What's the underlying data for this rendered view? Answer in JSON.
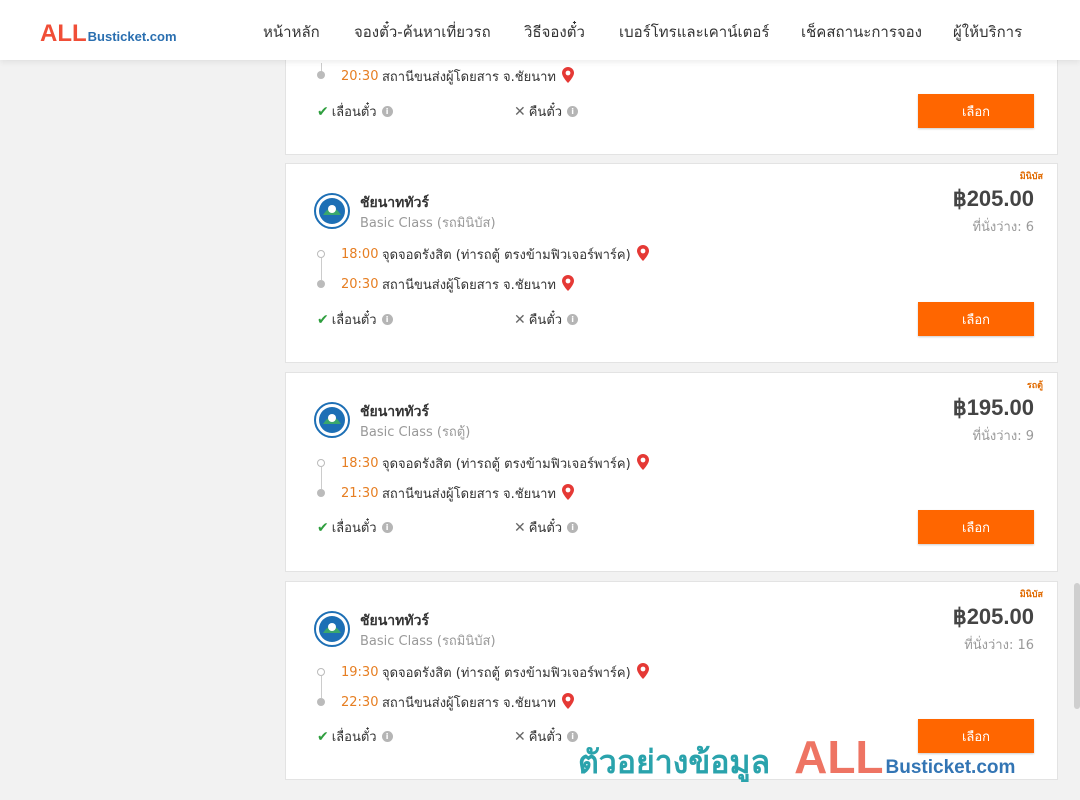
{
  "header": {
    "logo_all": "ALL",
    "logo_sub": "Busticket.com",
    "nav": [
      {
        "label": "หน้าหลัก"
      },
      {
        "label": "จองตั๋ว-ค้นหาเที่ยวรถ"
      },
      {
        "label": "วิธีจองตั๋ว"
      },
      {
        "label": "เบอร์โทรและเคาน์เตอร์"
      },
      {
        "label": "เช็คสถานะการจอง"
      },
      {
        "label": "ผู้ให้บริการ"
      }
    ]
  },
  "cards": [
    {
      "tag": "",
      "operator": "",
      "class": "",
      "price": "",
      "seats": "",
      "depart_time": "",
      "depart_stop": "",
      "arrive_time": "20:30",
      "arrive_stop": "สถานีขนส่งผู้โดยสาร จ.ชัยนาท",
      "change_label": "เลื่อนตั๋ว",
      "refund_label": "คืนตั๋ว",
      "select_label": "เลือก"
    },
    {
      "tag": "มินิบัส",
      "operator": "ชัยนาททัวร์",
      "class": "Basic Class (รถมินิบัส)",
      "price": "฿205.00",
      "seats": "ที่นั่งว่าง: 6",
      "depart_time": "18:00",
      "depart_stop": "จุดจอดรังสิต (ท่ารถตู้ ตรงข้ามฟิวเจอร์พาร์ค)",
      "arrive_time": "20:30",
      "arrive_stop": "สถานีขนส่งผู้โดยสาร จ.ชัยนาท",
      "change_label": "เลื่อนตั๋ว",
      "refund_label": "คืนตั๋ว",
      "select_label": "เลือก"
    },
    {
      "tag": "รถตู้",
      "operator": "ชัยนาททัวร์",
      "class": "Basic Class (รถตู้)",
      "price": "฿195.00",
      "seats": "ที่นั่งว่าง: 9",
      "depart_time": "18:30",
      "depart_stop": "จุดจอดรังสิต (ท่ารถตู้ ตรงข้ามฟิวเจอร์พาร์ค)",
      "arrive_time": "21:30",
      "arrive_stop": "สถานีขนส่งผู้โดยสาร จ.ชัยนาท",
      "change_label": "เลื่อนตั๋ว",
      "refund_label": "คืนตั๋ว",
      "select_label": "เลือก"
    },
    {
      "tag": "มินิบัส",
      "operator": "ชัยนาททัวร์",
      "class": "Basic Class (รถมินิบัส)",
      "price": "฿205.00",
      "seats": "ที่นั่งว่าง: 16",
      "depart_time": "19:30",
      "depart_stop": "จุดจอดรังสิต (ท่ารถตู้ ตรงข้ามฟิวเจอร์พาร์ค)",
      "arrive_time": "22:30",
      "arrive_stop": "สถานีขนส่งผู้โดยสาร จ.ชัยนาท",
      "change_label": "เลื่อนตั๋ว",
      "refund_label": "คืนตั๋ว",
      "select_label": "เลือก"
    }
  ],
  "watermark": {
    "thai": "ตัวอย่างข้อมูล",
    "all": "ALL",
    "sub": "Busticket.com"
  },
  "colors": {
    "accent": "#ff6600",
    "time": "#e67e22",
    "check": "#2e9e3e",
    "pin": "#e53935"
  }
}
